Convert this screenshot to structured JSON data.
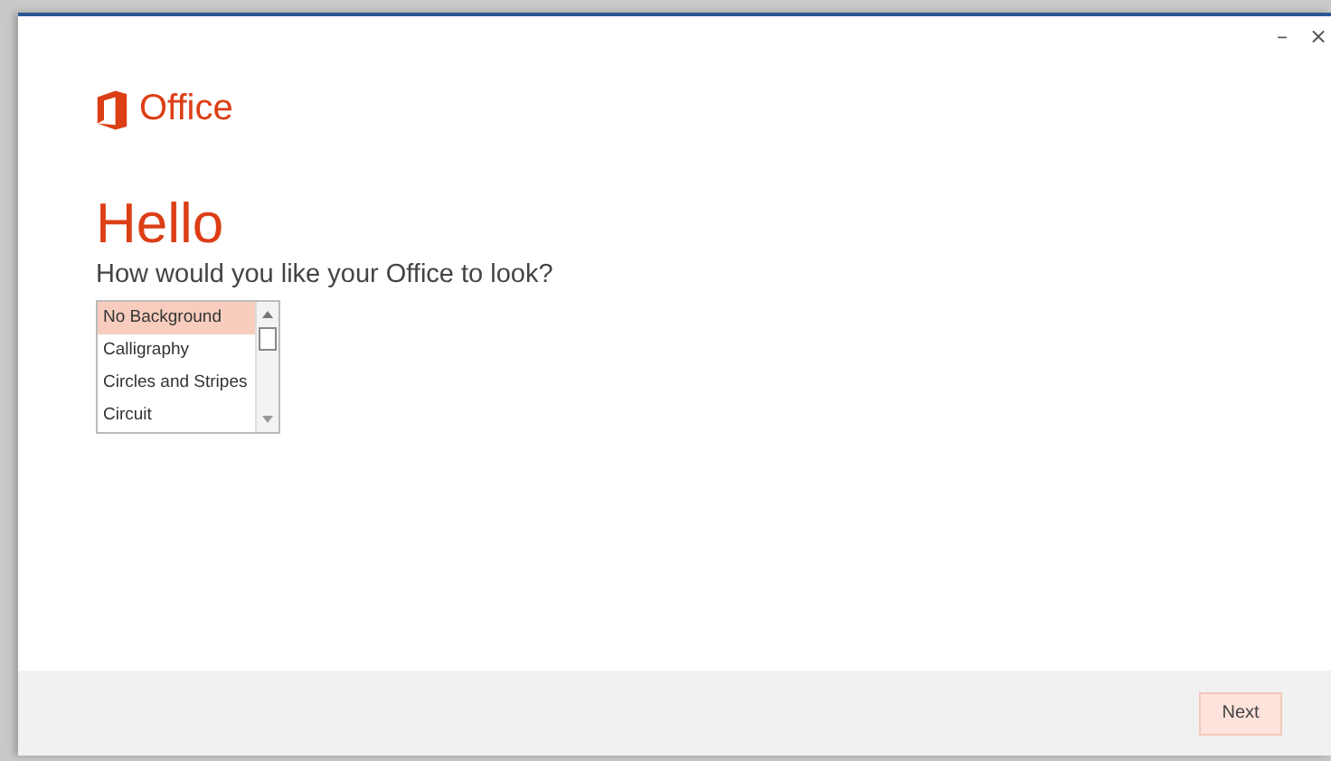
{
  "window": {
    "controls": [
      "–",
      "×"
    ]
  },
  "brand": {
    "name": "Office"
  },
  "heading": "Hello",
  "question": "How would you like your Office to look?",
  "backgrounds": [
    {
      "label": "No Background",
      "selected": true
    },
    {
      "label": "Calligraphy",
      "selected": false
    },
    {
      "label": "Circles and Stripes",
      "selected": false
    },
    {
      "label": "Circuit",
      "selected": false
    }
  ],
  "buttons": [
    "Next"
  ]
}
